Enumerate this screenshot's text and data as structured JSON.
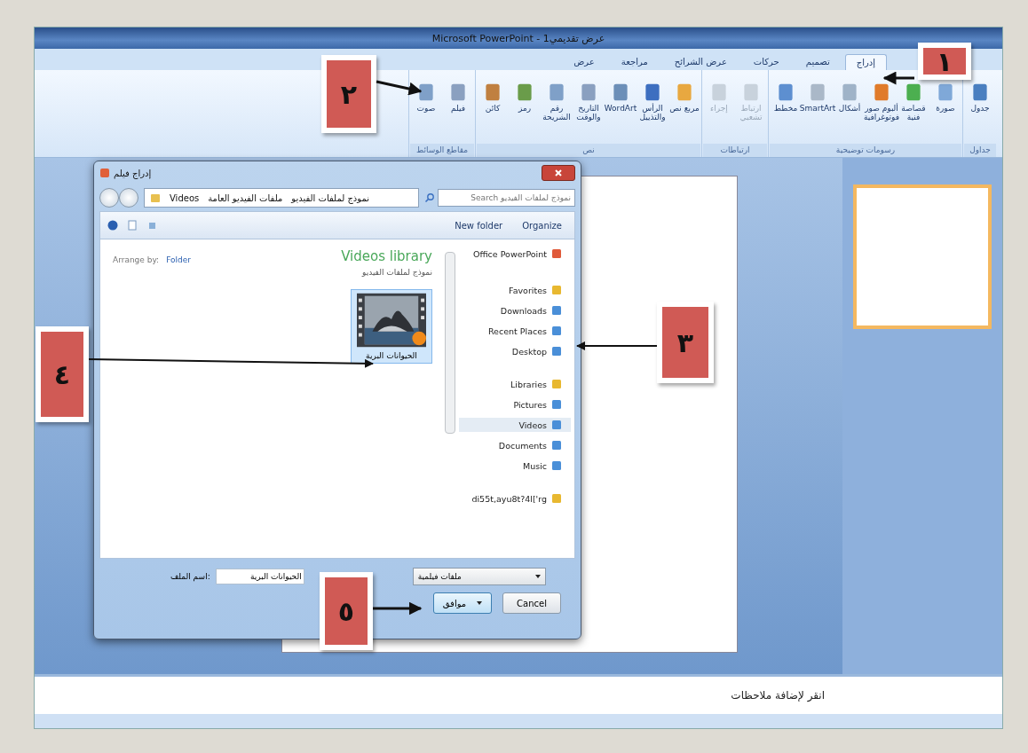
{
  "window": {
    "title": "عرض تقديمي1 - Microsoft PowerPoint"
  },
  "tabs": [
    {
      "label": "إدراج",
      "selected": true
    },
    {
      "label": "تصميم",
      "selected": false
    },
    {
      "label": "حركات",
      "selected": false
    },
    {
      "label": "عرض الشرائح",
      "selected": false
    },
    {
      "label": "مراجعة",
      "selected": false
    },
    {
      "label": "عرض",
      "selected": false
    }
  ],
  "ribbon": {
    "groups": [
      {
        "label": "جداول",
        "buttons": [
          {
            "label": "جدول",
            "disabled": false
          }
        ]
      },
      {
        "label": "رسومات توضيحية",
        "buttons": [
          {
            "label": "صورة",
            "disabled": false
          },
          {
            "label": "قصاصة فنية",
            "disabled": false
          },
          {
            "label": "ألبوم صور فوتوغرافية",
            "disabled": false
          },
          {
            "label": "أشكال",
            "disabled": false
          },
          {
            "label": "SmartArt",
            "disabled": false
          },
          {
            "label": "مخطط",
            "disabled": false
          }
        ]
      },
      {
        "label": "ارتباطات",
        "buttons": [
          {
            "label": "ارتباط تشعبي",
            "disabled": true
          },
          {
            "label": "إجراء",
            "disabled": true
          }
        ]
      },
      {
        "label": "نص",
        "buttons": [
          {
            "label": "مربع نص",
            "disabled": false
          },
          {
            "label": "الرأس والتذييل",
            "disabled": false
          },
          {
            "label": "WordArt",
            "disabled": false
          },
          {
            "label": "التاريخ والوقت",
            "disabled": false
          },
          {
            "label": "رقم الشريحة",
            "disabled": false
          },
          {
            "label": "رمز",
            "disabled": false
          },
          {
            "label": "كائن",
            "disabled": false
          }
        ]
      },
      {
        "label": "مقاطع الوسائط",
        "buttons": [
          {
            "label": "فيلم",
            "disabled": false
          },
          {
            "label": "صوت",
            "disabled": false
          }
        ]
      }
    ]
  },
  "dialog": {
    "title": "إدراج فيلم",
    "breadcrumbs": [
      "نموذج لملفات الفيديو",
      "ملفات الفيديو العامة",
      "Videos"
    ],
    "search": {
      "placeholder": "Search نموذج لملفات الفيديو"
    },
    "toolbar": [
      "Organize",
      "New folder"
    ],
    "nav": [
      {
        "label": "Office PowerPoint",
        "kind": "root",
        "selected": false
      },
      {
        "label": "Favorites",
        "kind": "header",
        "selected": false
      },
      {
        "label": "Downloads",
        "kind": "item",
        "selected": false
      },
      {
        "label": "Recent Places",
        "kind": "item",
        "selected": false
      },
      {
        "label": "Desktop",
        "kind": "item",
        "selected": false
      },
      {
        "label": "Libraries",
        "kind": "header",
        "selected": false
      },
      {
        "label": "Pictures",
        "kind": "item",
        "selected": false
      },
      {
        "label": "Videos",
        "kind": "item",
        "selected": true
      },
      {
        "label": "Documents",
        "kind": "item",
        "selected": false
      },
      {
        "label": "Music",
        "kind": "item",
        "selected": false
      },
      {
        "label": "di55t,ayu8t?4l['rg",
        "kind": "header",
        "selected": false
      }
    ],
    "library": {
      "title": "Videos library",
      "subtitle": "نموذج لملفات الفيديو",
      "arrange_label": "Arrange by:",
      "arrange_value": "Folder"
    },
    "files": [
      {
        "name": "الحيوانات البرية",
        "selected": true
      }
    ],
    "filename": {
      "label": "اسم الملف:",
      "value": "الحيوانات البرية"
    },
    "filter": "ملفات فيلمية",
    "buttons": [
      {
        "label": "Cancel",
        "kind": "plain"
      },
      {
        "label": "موافق",
        "kind": "split"
      }
    ]
  },
  "notes": {
    "placeholder": "انقر لإضافة ملاحظات"
  },
  "callouts": [
    {
      "number": "١"
    },
    {
      "number": "٢"
    },
    {
      "number": "٣"
    },
    {
      "number": "٤"
    },
    {
      "number": "٥"
    }
  ]
}
